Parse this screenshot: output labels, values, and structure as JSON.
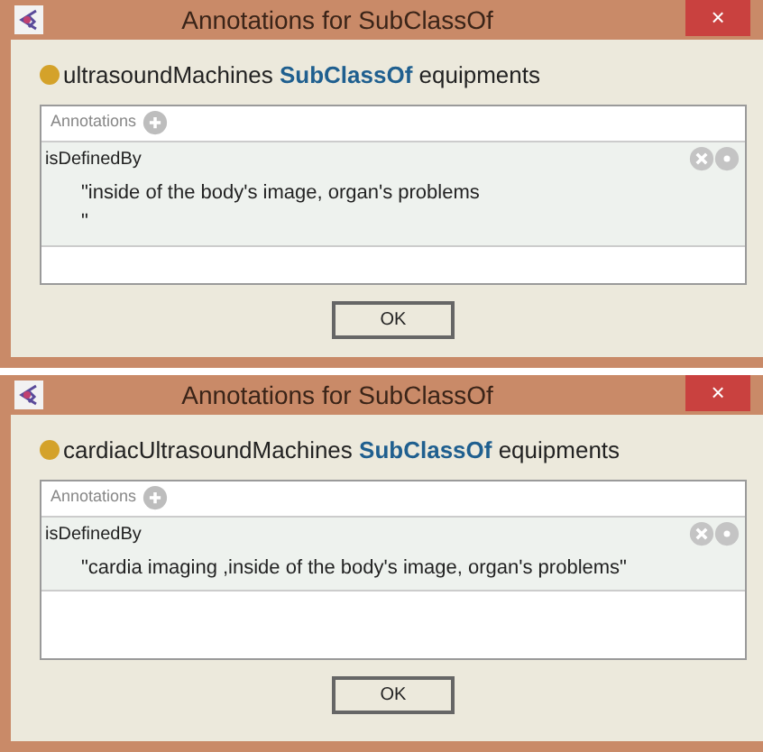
{
  "dialogs": [
    {
      "title": "Annotations for SubClassOf",
      "close": "×",
      "axiom": {
        "subject": "ultrasoundMachines",
        "keyword": "SubClassOf",
        "object": "equipments"
      },
      "annotations_label": "Annotations",
      "annotations": [
        {
          "property": "isDefinedBy",
          "value": "\"inside of the body's image, organ's problems\n\""
        }
      ],
      "button": "OK"
    },
    {
      "title": "Annotations for SubClassOf",
      "close": "×",
      "axiom": {
        "subject": "cardiacUltrasoundMachines",
        "keyword": "SubClassOf",
        "object": "equipments"
      },
      "annotations_label": "Annotations",
      "annotations": [
        {
          "property": "isDefinedBy",
          "value": "\"cardia imaging ,inside of the body's image, organ's problems\""
        }
      ],
      "button": "OK"
    }
  ]
}
